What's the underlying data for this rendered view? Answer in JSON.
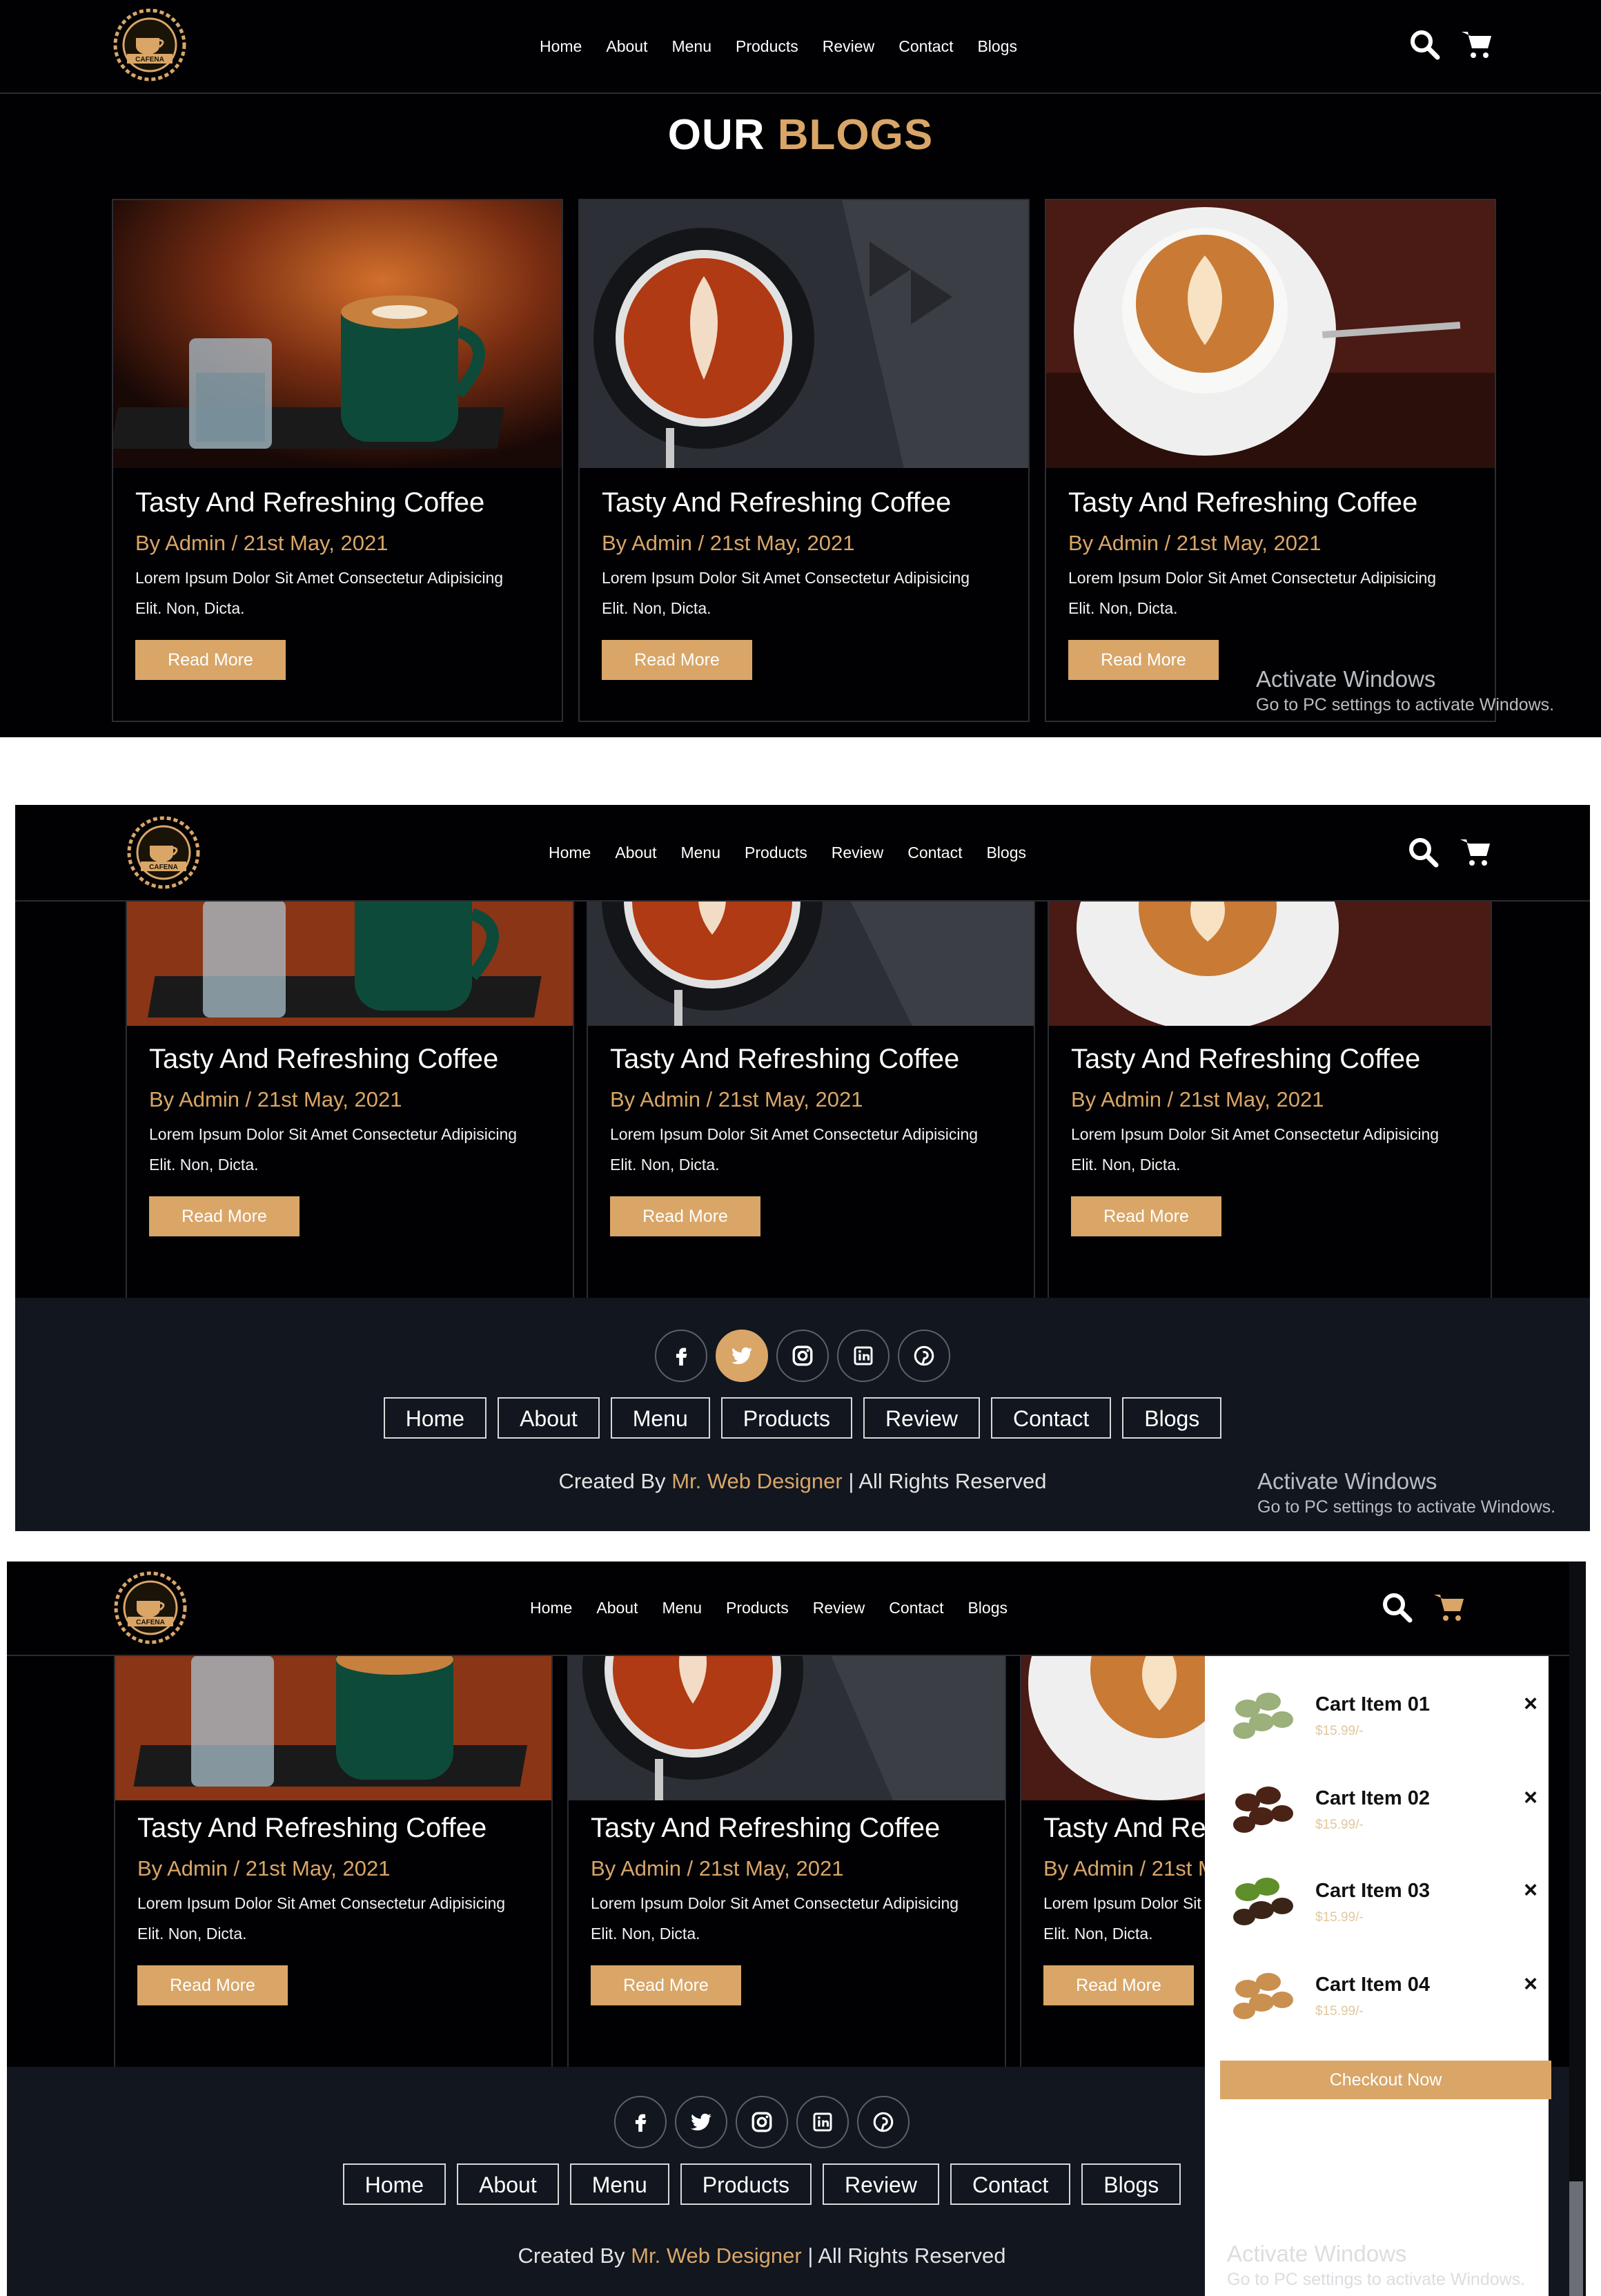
{
  "nav": {
    "brand": "CAFENA",
    "items": [
      "Home",
      "About",
      "Menu",
      "Products",
      "Review",
      "Contact",
      "Blogs"
    ]
  },
  "section": {
    "title_white": "OUR",
    "title_accent": "BLOGS"
  },
  "blog": {
    "title": "Tasty And Refreshing Coffee",
    "meta": "By Admin / 21st May, 2021",
    "desc_line1": "Lorem Ipsum Dolor Sit Amet Consectetur Adipisicing",
    "desc_line2": "Elit. Non, Dicta.",
    "button": "Read More"
  },
  "footer": {
    "socials": [
      "facebook-icon",
      "twitter-icon",
      "instagram-icon",
      "linkedin-icon",
      "pinterest-icon"
    ],
    "links": [
      "Home",
      "About",
      "Menu",
      "Products",
      "Review",
      "Contact",
      "Blogs"
    ],
    "credit_prefix": "Created By",
    "credit_name": "Mr. Web Designer",
    "credit_suffix": "| All Rights Reserved"
  },
  "cart": {
    "items": [
      {
        "name": "Cart Item 01",
        "price": "$15.99/-"
      },
      {
        "name": "Cart Item 02",
        "price": "$15.99/-"
      },
      {
        "name": "Cart Item 03",
        "price": "$15.99/-"
      },
      {
        "name": "Cart Item 04",
        "price": "$15.99/-"
      }
    ],
    "checkout": "Checkout Now",
    "remove_symbol": "×"
  },
  "watermark": {
    "title": "Activate Windows",
    "subtitle": "Go to PC settings to activate Windows."
  },
  "colors": {
    "accent": "#d9a668",
    "background": "#010103",
    "footer": "#11161f"
  }
}
